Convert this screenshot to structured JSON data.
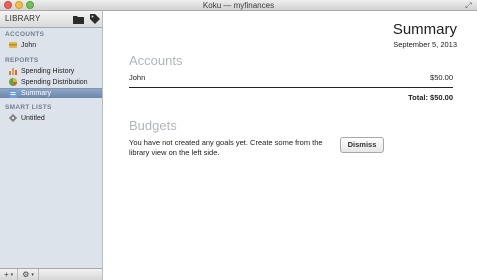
{
  "window": {
    "title": "Koku — myfinances"
  },
  "sidebar": {
    "header_label": "LIBRARY",
    "sections": [
      {
        "title": "ACCOUNTS",
        "items": [
          {
            "label": "John",
            "icon": "account-icon",
            "selected": false
          }
        ]
      },
      {
        "title": "REPORTS",
        "items": [
          {
            "label": "Spending History",
            "icon": "bar-chart-icon",
            "selected": false
          },
          {
            "label": "Spending Distribution",
            "icon": "pie-chart-icon",
            "selected": false
          },
          {
            "label": "Summary",
            "icon": "summary-icon",
            "selected": true
          }
        ]
      },
      {
        "title": "SMART LISTS",
        "items": [
          {
            "label": "Untitled",
            "icon": "gear-icon",
            "selected": false
          }
        ]
      }
    ],
    "footer": {
      "add_label": "+",
      "action_label": "⚙"
    }
  },
  "main": {
    "title": "Summary",
    "date": "September 5, 2013",
    "accounts": {
      "heading": "Accounts",
      "rows": [
        {
          "name": "John",
          "amount": "$50.00"
        }
      ],
      "total": "Total: $50.00"
    },
    "budgets": {
      "heading": "Budgets",
      "message": "You have not created any goals yet. Create some from the library view on the left side.",
      "dismiss_label": "Dismiss"
    }
  },
  "colors": {
    "selection": "#7a92b5",
    "sidebar_bg": "#dde3ea",
    "heading_gray": "#b1b6bd"
  }
}
